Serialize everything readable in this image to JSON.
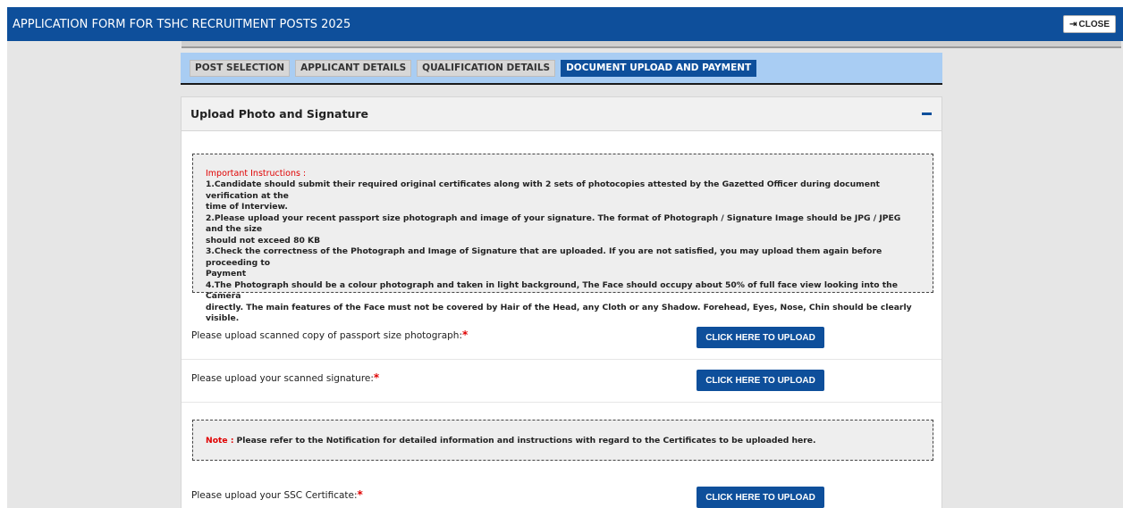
{
  "header": {
    "title": "APPLICATION FORM FOR TSHC RECRUITMENT POSTS 2025",
    "close_icon": "sign-out-icon",
    "close_label": "CLOSE"
  },
  "tabs": [
    {
      "label": "POST SELECTION",
      "active": false
    },
    {
      "label": "APPLICANT DETAILS",
      "active": false
    },
    {
      "label": "QUALIFICATION DETAILS",
      "active": false
    },
    {
      "label": "DOCUMENT UPLOAD AND PAYMENT",
      "active": true
    }
  ],
  "panel": {
    "title": "Upload Photo and Signature",
    "collapse_icon": "minus-icon"
  },
  "instructions": {
    "heading": "Important Instructions :",
    "lines": [
      "1.Candidate should submit their required original certificates along with 2 sets of photocopies attested by the Gazetted Officer during document verification at the",
      "time of Interview.",
      "2.Please upload your recent passport size photograph and image of your signature. The format of Photograph / Signature Image should be JPG / JPEG and the size",
      "should not exceed 80 KB",
      "3.Check the correctness of the Photograph and Image of Signature that are uploaded. If you are not satisfied, you may upload them again before proceeding to",
      "Payment",
      "4.The Photograph should be a colour photograph and taken in light background, The Face should occupy about 50% of full face view looking into the Camera",
      "directly. The main features of the Face must not be covered by Hair of the Head, any Cloth or any Shadow. Forehead, Eyes, Nose, Chin should be clearly visible."
    ]
  },
  "uploads": [
    {
      "label": "Please upload scanned copy of passport size photograph:",
      "required": "*",
      "button": "CLICK HERE TO UPLOAD"
    },
    {
      "label": "Please upload your scanned signature:",
      "required": "*",
      "button": "CLICK HERE TO UPLOAD"
    },
    {
      "label": "Please upload your SSC Certificate:",
      "required": "*",
      "button": "CLICK HERE TO UPLOAD"
    }
  ],
  "note": {
    "label": "Note :",
    "text": "Please refer to the Notification for detailed information and instructions with regard to the Certificates to be uploaded here."
  },
  "colors": {
    "header_blue": "#0e4f9b",
    "tab_bar": "#a9cdf3",
    "required_red": "#e00000"
  }
}
